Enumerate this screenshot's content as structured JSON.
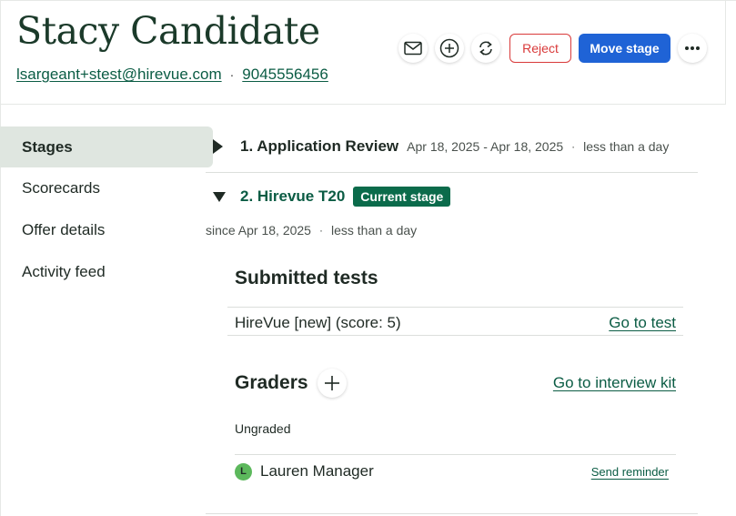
{
  "candidate": {
    "name": "Stacy Candidate",
    "email": "lsargeant+stest@hirevue.com",
    "separator": "·",
    "phone": "9045556456"
  },
  "actions": {
    "email_icon": "mail-icon",
    "add_icon": "plus-circle-icon",
    "transfer_icon": "refresh-icon",
    "reject_label": "Reject",
    "move_stage_label": "Move stage",
    "more_icon": "ellipsis-icon"
  },
  "colors": {
    "brand_green": "#0b5c44",
    "badge_green": "#0b6b4b",
    "primary_blue": "#1f63d6",
    "reject_red": "#d93a3a",
    "avatar_green": "#5cb85c"
  },
  "sidebar": {
    "items": [
      {
        "label": "Stages",
        "active": true
      },
      {
        "label": "Scorecards",
        "active": false
      },
      {
        "label": "Offer details",
        "active": false
      },
      {
        "label": "Activity feed",
        "active": false
      }
    ]
  },
  "stages": [
    {
      "title": "1. Application Review",
      "dates": "Apr 18, 2025 - Apr 18, 2025",
      "separator": "·",
      "duration": "less than a day",
      "expanded": false
    },
    {
      "title": "2. Hirevue T20",
      "badge": "Current stage",
      "since": "since Apr 18, 2025",
      "separator": "·",
      "duration": "less than a day",
      "expanded": true
    }
  ],
  "submitted_tests": {
    "title": "Submitted tests",
    "rows": [
      {
        "name": "HireVue [new] (score: 5)",
        "link": "Go to test"
      }
    ]
  },
  "graders": {
    "title": "Graders",
    "add_icon": "plus-icon",
    "kit_link": "Go to interview kit",
    "status": "Ungraded",
    "list": [
      {
        "initial": "L",
        "name": "Lauren Manager",
        "action": "Send reminder"
      }
    ]
  }
}
